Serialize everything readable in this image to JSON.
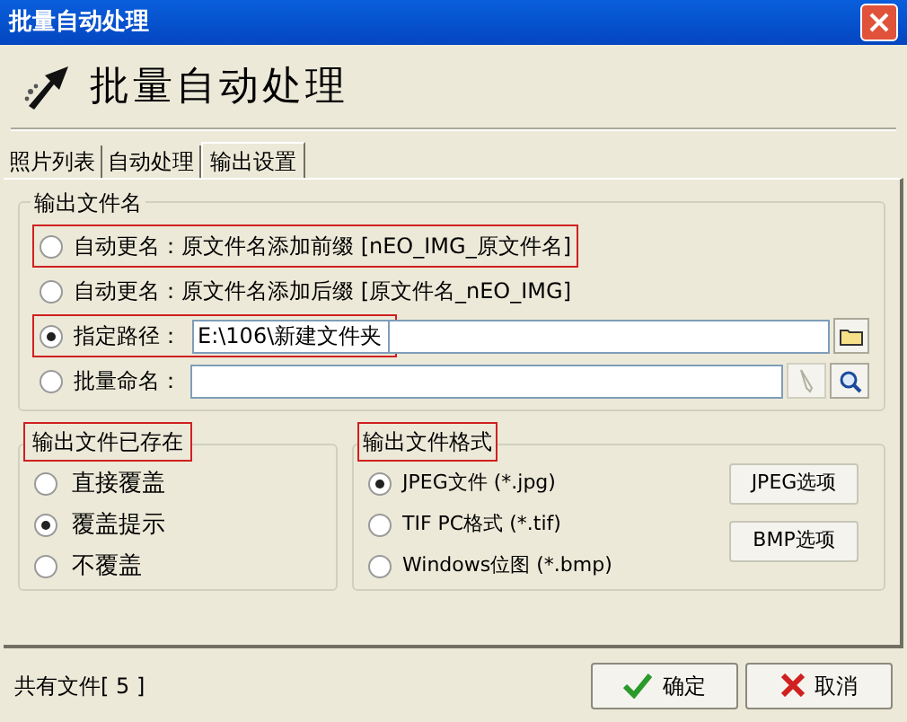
{
  "window": {
    "title": "批量自动处理"
  },
  "header": {
    "title": "批量自动处理"
  },
  "tabs": [
    {
      "label": "照片列表",
      "selected": false
    },
    {
      "label": "自动处理",
      "selected": false
    },
    {
      "label": "输出设置",
      "selected": true
    }
  ],
  "output_name": {
    "title": "输出文件名",
    "options": [
      {
        "kind": "plain",
        "label": "自动更名：原文件名添加前缀 [nEO_IMG_原文件名]",
        "selected": false,
        "highlighted": true
      },
      {
        "kind": "plain",
        "label": "自动更名：原文件名添加后缀 [原文件名_nEO_IMG]",
        "selected": false,
        "highlighted": false
      },
      {
        "kind": "path",
        "label": "指定路径：",
        "value": "E:\\106\\新建文件夹",
        "selected": true,
        "highlighted": true
      },
      {
        "kind": "batch",
        "label": "批量命名：",
        "selected": false,
        "highlighted": false
      }
    ]
  },
  "if_exists": {
    "title": "输出文件已存在",
    "highlighted": true,
    "options": [
      {
        "label": "直接覆盖",
        "selected": false
      },
      {
        "label": "覆盖提示",
        "selected": true
      },
      {
        "label": "不覆盖",
        "selected": false
      }
    ]
  },
  "format": {
    "title": "输出文件格式",
    "highlighted": true,
    "options": [
      {
        "label": "JPEG文件 (*.jpg)",
        "selected": true
      },
      {
        "label": "TIF PC格式 (*.tif)",
        "selected": false
      },
      {
        "label": "Windows位图 (*.bmp)",
        "selected": false
      }
    ],
    "buttons": [
      "JPEG选项",
      "BMP选项"
    ]
  },
  "status": "共有文件[ 5 ]",
  "buttons": [
    {
      "kind": "ok",
      "label": "确定"
    },
    {
      "kind": "cancel",
      "label": "取消"
    }
  ]
}
